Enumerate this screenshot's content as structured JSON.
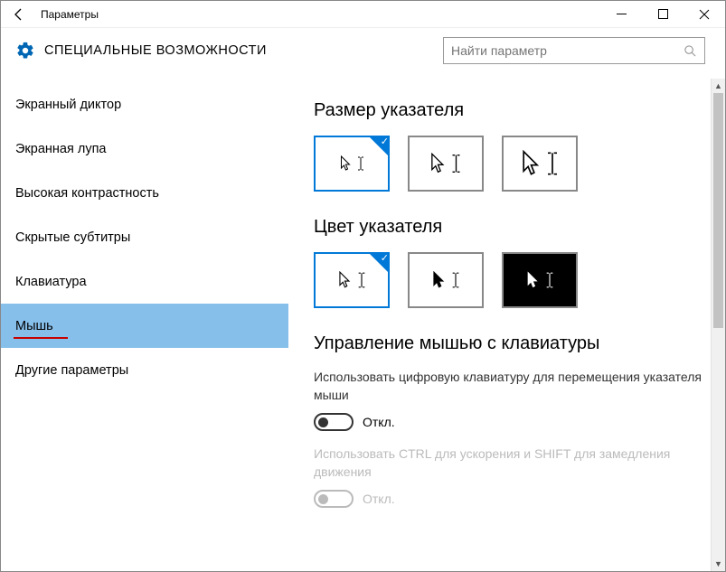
{
  "window": {
    "title": "Параметры"
  },
  "header": {
    "page_title": "СПЕЦИАЛЬНЫЕ ВОЗМОЖНОСТИ",
    "search_placeholder": "Найти параметр"
  },
  "sidebar": {
    "items": [
      {
        "label": "Экранный диктор"
      },
      {
        "label": "Экранная лупа"
      },
      {
        "label": "Высокая контрастность"
      },
      {
        "label": "Скрытые субтитры"
      },
      {
        "label": "Клавиатура"
      },
      {
        "label": "Мышь"
      },
      {
        "label": "Другие параметры"
      }
    ]
  },
  "content": {
    "pointer_size_heading": "Размер указателя",
    "pointer_color_heading": "Цвет указателя",
    "mouse_keys_heading": "Управление мышью с клавиатуры",
    "mouse_keys_desc": "Использовать цифровую клавиатуру для перемещения указателя мыши",
    "toggle_off": "Откл.",
    "ctrl_shift_desc": "Использовать CTRL для ускорения и SHIFT для замедления движения",
    "toggle_off2": "Откл."
  }
}
